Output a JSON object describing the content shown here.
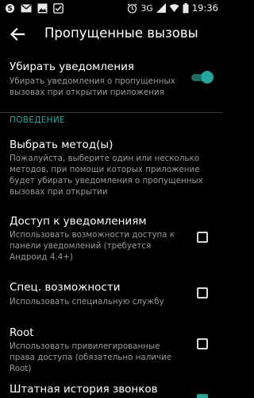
{
  "status_bar": {
    "icons_left": [
      "skype-icon",
      "mail-icon",
      "image-icon",
      "checkbox-done-icon"
    ],
    "icons_right": [
      "alarm-icon",
      "signal-icon",
      "wifi-icon",
      "battery-icon"
    ],
    "network": "3G",
    "time": "19:36"
  },
  "app_bar": {
    "back_icon": "arrow-back-icon",
    "title": "Пропущенные вызовы"
  },
  "settings": {
    "remove_notifications": {
      "title": "Убирать уведомления",
      "subtitle": "Убирать уведомления о пропущенных вызовах при открытии приложения",
      "enabled": true
    },
    "section_behavior": "ПОВЕДЕНИЕ",
    "choose_method": {
      "title": "Выбрать метод(ы)",
      "subtitle": "Пожалуйста, выберите один или несколько методов, при помощи которых приложение будет убирать уведомления о пропущенных вызовах при открытии"
    },
    "notification_access": {
      "title": "Доступ к уведомлениям",
      "subtitle": "Использовать возможности доступа к панели уведомлений (требуется Андроид 4.4+)",
      "checked": false
    },
    "accessibility": {
      "title": "Спец. возможности",
      "subtitle": "Использовать специальную службу",
      "checked": false
    },
    "root": {
      "title": "Root",
      "subtitle": "Использовать привилегированные права доступа (обязательно наличие Root)",
      "checked": false
    },
    "call_history": {
      "title": "Штатная история звонков",
      "checked": true
    }
  },
  "colors": {
    "accent": "#26a69a",
    "background": "#000000",
    "secondary_text": "#9a9a9a"
  }
}
